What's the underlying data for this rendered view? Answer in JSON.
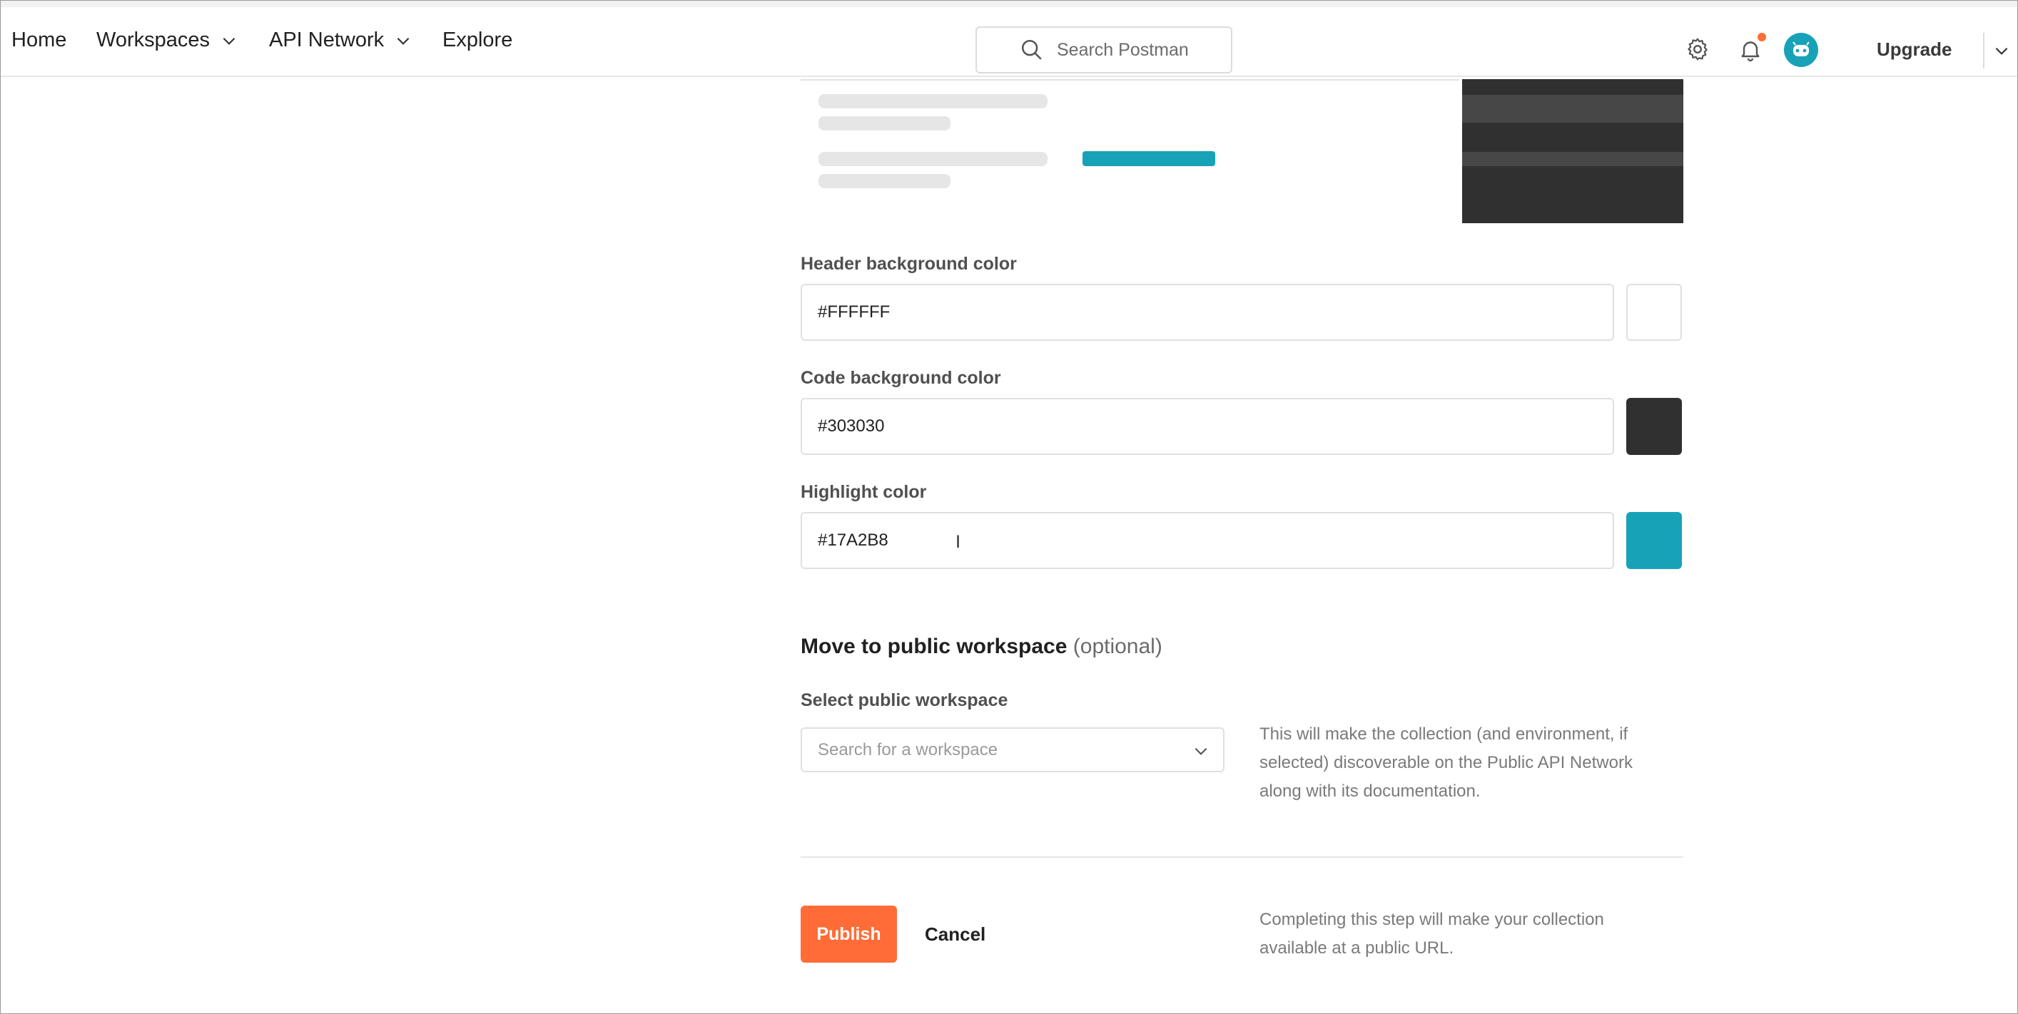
{
  "nav": {
    "home": "Home",
    "workspaces": "Workspaces",
    "api_network": "API Network",
    "explore": "Explore",
    "search_placeholder": "Search Postman",
    "upgrade": "Upgrade",
    "icons": [
      "search-icon",
      "gear-icon",
      "bell-icon",
      "avatar",
      "chevron-down-icon"
    ]
  },
  "form": {
    "header_bg": {
      "label": "Header background color",
      "value": "#FFFFFF",
      "swatch": "#FFFFFF"
    },
    "code_bg": {
      "label": "Code background color",
      "value": "#303030",
      "swatch": "#303030"
    },
    "highlight": {
      "label": "Highlight color",
      "value": "#17A2B8",
      "swatch": "#17A2B8"
    }
  },
  "public_workspace": {
    "title": "Move to public workspace",
    "optional": "(optional)",
    "select_label": "Select public workspace",
    "select_placeholder": "Search for a workspace",
    "help_text": "This will make the collection (and environment, if selected) discoverable on the Public API Network along with its documentation."
  },
  "footer": {
    "publish": "Publish",
    "cancel": "Cancel",
    "help_text": "Completing this step will make your collection available at a public URL."
  },
  "colors": {
    "accent": "#FF6C37",
    "highlight": "#17A2B8",
    "code": "#303030"
  }
}
